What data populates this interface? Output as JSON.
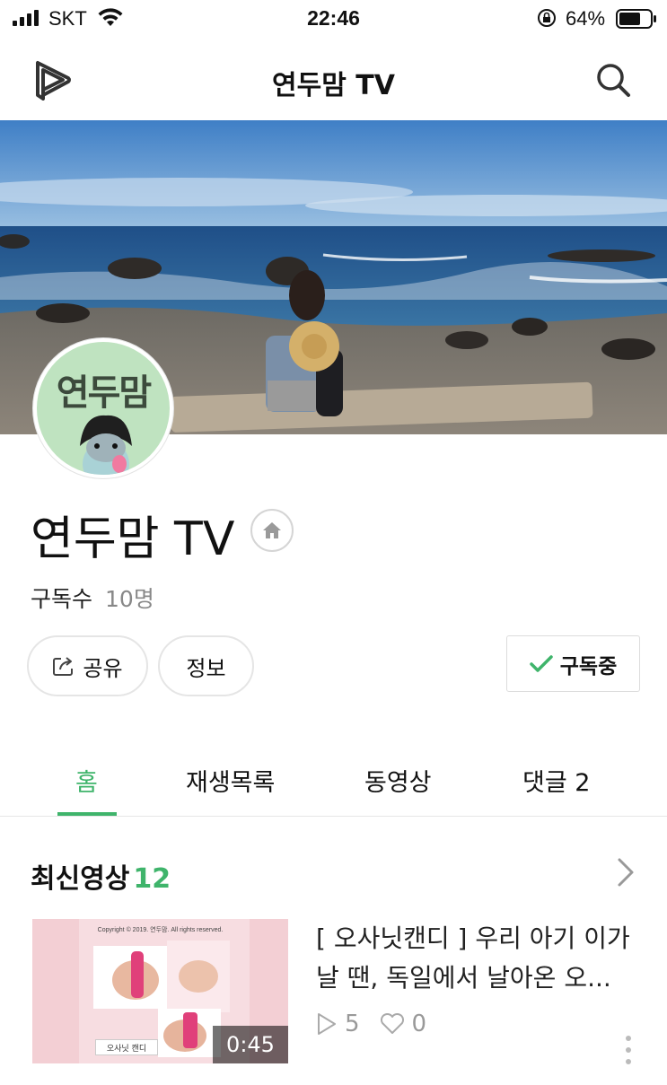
{
  "status_bar": {
    "carrier": "SKT",
    "time": "22:46",
    "battery": "64%"
  },
  "nav": {
    "title": "연두맘 TV",
    "logo_icon": "kakaotv-play-logo-icon",
    "search_icon": "search-icon"
  },
  "channel": {
    "avatar_text": "연두맘",
    "name": "연두맘 TV",
    "subscribers_label": "구독수",
    "subscribers_count": "10명"
  },
  "actions": {
    "share_label": "공유",
    "info_label": "정보",
    "subscribed_label": "구독중"
  },
  "tabs": [
    {
      "label": "홈",
      "active": true
    },
    {
      "label": "재생목록",
      "active": false
    },
    {
      "label": "동영상",
      "active": false
    },
    {
      "label": "댓글 2",
      "active": false
    }
  ],
  "latest": {
    "title": "최신영상",
    "count": "12"
  },
  "videos": [
    {
      "title": "[ 오사닛캔디 ] 우리 아기 이가 날 땐, 독일에서 날아온 오...",
      "duration": "0:45",
      "views": "5",
      "likes": "0",
      "thumb_copyright": "Copyright © 2019. 연두맘. All rights reserved.",
      "thumb_tag": "오사닛 캔디"
    }
  ],
  "colors": {
    "accent": "#3fb46b",
    "muted": "#999999"
  }
}
